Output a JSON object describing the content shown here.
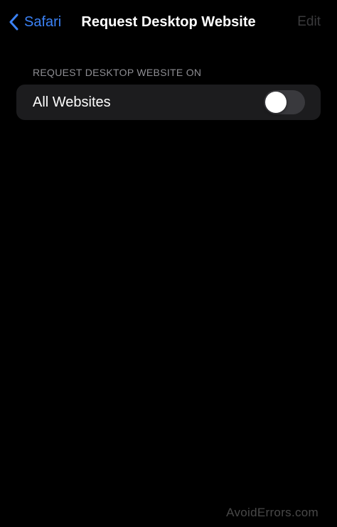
{
  "nav": {
    "back_label": "Safari",
    "title": "Request Desktop Website",
    "edit_label": "Edit"
  },
  "section": {
    "header": "REQUEST DESKTOP WEBSITE ON",
    "rows": [
      {
        "label": "All Websites",
        "toggle_on": false
      }
    ]
  },
  "watermark": "AvoidErrors.com",
  "colors": {
    "background": "#000000",
    "group_background": "#1c1c1e",
    "accent": "#3b82f6",
    "disabled_text": "#3a3a3c",
    "secondary_text": "#8e8e93",
    "toggle_off": "#39393d"
  },
  "icons": {
    "back": "chevron-left-icon"
  }
}
